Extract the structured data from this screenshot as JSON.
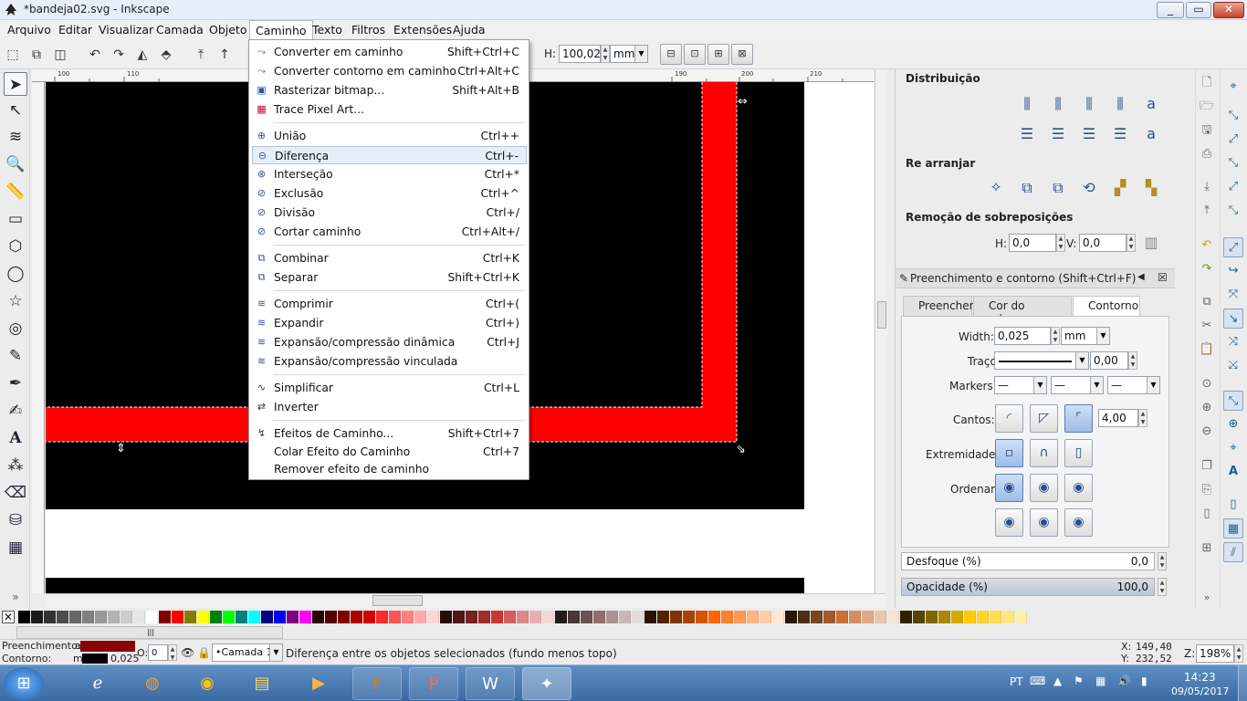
{
  "window": {
    "title": "*bandeja02.svg - Inkscape",
    "min": "_",
    "max": "▭",
    "close": "✕"
  },
  "menubar": [
    "Arquivo",
    "Editar",
    "Visualizar",
    "Camada",
    "Objeto",
    "Caminho",
    "Texto",
    "Filtros",
    "Extensões",
    "Ajuda"
  ],
  "toolbar": {
    "h_label": "H:",
    "h_value": "100,025",
    "unit": "mm"
  },
  "ruler": {
    "top_ticks": [
      "100",
      "110",
      "190",
      "200",
      "210"
    ]
  },
  "caminho_menu": [
    {
      "label": "Converter em caminho",
      "shortcut": "Shift+Ctrl+C",
      "icon": "object-to-path-icon"
    },
    {
      "label": "Converter contorno em caminho",
      "shortcut": "Ctrl+Alt+C",
      "icon": "stroke-to-path-icon"
    },
    {
      "label": "Rasterizar bitmap...",
      "shortcut": "Shift+Alt+B",
      "icon": "trace-bitmap-icon"
    },
    {
      "label": "Trace Pixel Art...",
      "shortcut": "",
      "icon": "trace-pixel-art-icon"
    },
    {
      "label": "União",
      "shortcut": "Ctrl++",
      "icon": "path-union-icon"
    },
    {
      "label": "Diferença",
      "shortcut": "Ctrl+-",
      "icon": "path-difference-icon"
    },
    {
      "label": "Interseção",
      "shortcut": "Ctrl+*",
      "icon": "path-intersection-icon"
    },
    {
      "label": "Exclusão",
      "shortcut": "Ctrl+^",
      "icon": "path-exclusion-icon"
    },
    {
      "label": "Divisão",
      "shortcut": "Ctrl+/",
      "icon": "path-division-icon"
    },
    {
      "label": "Cortar caminho",
      "shortcut": "Ctrl+Alt+/",
      "icon": "path-cut-icon"
    },
    {
      "label": "Combinar",
      "shortcut": "Ctrl+K",
      "icon": "path-combine-icon"
    },
    {
      "label": "Separar",
      "shortcut": "Shift+Ctrl+K",
      "icon": "path-break-apart-icon"
    },
    {
      "label": "Comprimir",
      "shortcut": "Ctrl+(",
      "icon": "path-inset-icon"
    },
    {
      "label": "Expandir",
      "shortcut": "Ctrl+)",
      "icon": "path-outset-icon"
    },
    {
      "label": "Expansão/compressão dinâmica",
      "shortcut": "Ctrl+J",
      "icon": "dynamic-offset-icon"
    },
    {
      "label": "Expansão/compressão vinculada",
      "shortcut": "",
      "icon": "linked-offset-icon"
    },
    {
      "label": "Simplificar",
      "shortcut": "Ctrl+L",
      "icon": "path-simplify-icon"
    },
    {
      "label": "Inverter",
      "shortcut": "",
      "icon": "path-reverse-icon"
    },
    {
      "label": "Efeitos de Caminho...",
      "shortcut": "Shift+Ctrl+7",
      "icon": "path-effects-icon"
    },
    {
      "label": "Colar Efeito do Caminho",
      "shortcut": "Ctrl+7",
      "icon": ""
    },
    {
      "label": "Remover efeito de caminho",
      "shortcut": "",
      "icon": ""
    }
  ],
  "panel": {
    "distribuicao": "Distribuição",
    "rearranjar": "Re arranjar",
    "remocao": "Remoção de sobreposições",
    "h_label": "H:",
    "h_value": "0,0",
    "v_label": "V:",
    "v_value": "0,0",
    "fill_stroke_title": "Preenchimento e contorno (Shift+Ctrl+F)",
    "tabs": [
      "Preencher",
      "Cor do contorno",
      "Contorno"
    ],
    "width_label": "Width:",
    "width_value": "0,025",
    "width_unit": "mm",
    "tracos_label": "Traços:",
    "tracos_value": "0,00",
    "markers_label": "Markers:",
    "cantos_label": "Cantos:",
    "cantos_value": "4,00",
    "extremidades_label": "Extremidades:",
    "ordenar_label": "Ordenar:",
    "desfoque_label": "Desfoque (%)",
    "desfoque_value": "0,0",
    "opacidade_label": "Opacidade (%)",
    "opacidade_value": "100,0"
  },
  "status": {
    "preenchimento_label": "Preenchimento:",
    "preenchimento_value": "a",
    "contorno_label": "Contorno:",
    "contorno_value": "m",
    "stroke_width": "0,025",
    "opacity_label": "O:",
    "opacity_value": "0",
    "layer": "•Camada 1",
    "message": "Diferença entre os objetos selecionados (fundo menos topo)",
    "x_label": "X:",
    "x_value": "149,40",
    "y_label": "Y:",
    "y_value": "232,52",
    "zoom_label": "Z:",
    "zoom_value": "198%"
  },
  "taskbar": {
    "lang": "PT",
    "time": "14:23",
    "date": "09/05/2017"
  },
  "colors": {
    "canvas_red": "#ff0000",
    "canvas_black": "#000000",
    "fill_swatch": "#8b0000",
    "highlight": "#e6eefa"
  }
}
